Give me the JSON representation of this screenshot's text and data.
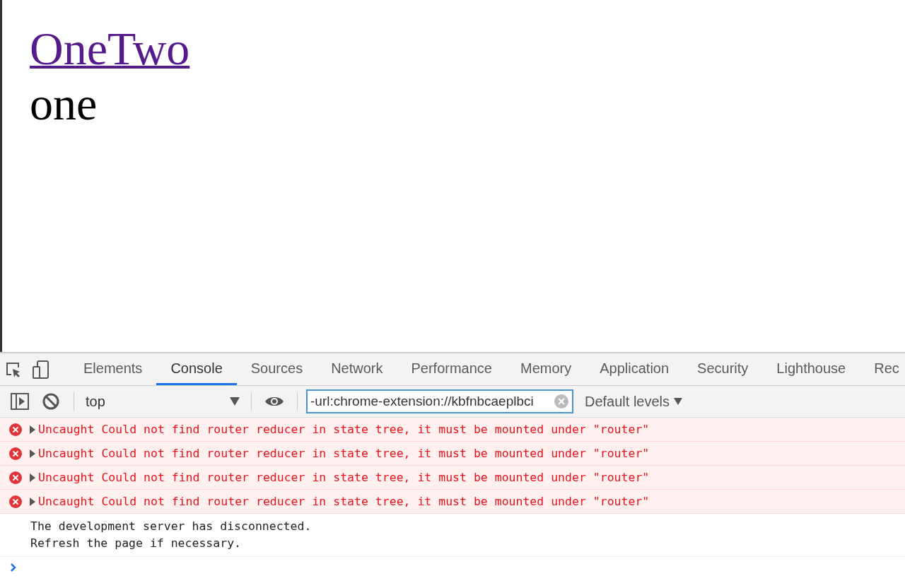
{
  "page": {
    "link": "OneTwo",
    "text": "one"
  },
  "devtools": {
    "tabs": [
      {
        "label": "Elements",
        "selected": false
      },
      {
        "label": "Console",
        "selected": true
      },
      {
        "label": "Sources",
        "selected": false
      },
      {
        "label": "Network",
        "selected": false
      },
      {
        "label": "Performance",
        "selected": false
      },
      {
        "label": "Memory",
        "selected": false
      },
      {
        "label": "Application",
        "selected": false
      },
      {
        "label": "Security",
        "selected": false
      },
      {
        "label": "Lighthouse",
        "selected": false
      },
      {
        "label": "Rec",
        "selected": false
      }
    ],
    "context": "top",
    "filter": "-url:chrome-extension://kbfnbcaeplbci",
    "levels": "Default levels",
    "messages": [
      {
        "kind": "error",
        "text": "Uncaught Could not find router reducer in state tree, it must be mounted under \"router\""
      },
      {
        "kind": "error",
        "text": "Uncaught Could not find router reducer in state tree, it must be mounted under \"router\""
      },
      {
        "kind": "error",
        "text": "Uncaught Could not find router reducer in state tree, it must be mounted under \"router\""
      },
      {
        "kind": "error",
        "text": "Uncaught Could not find router reducer in state tree, it must be mounted under \"router\""
      },
      {
        "kind": "info",
        "lines": [
          "The development server has disconnected.",
          "Refresh the page if necessary."
        ]
      }
    ]
  }
}
